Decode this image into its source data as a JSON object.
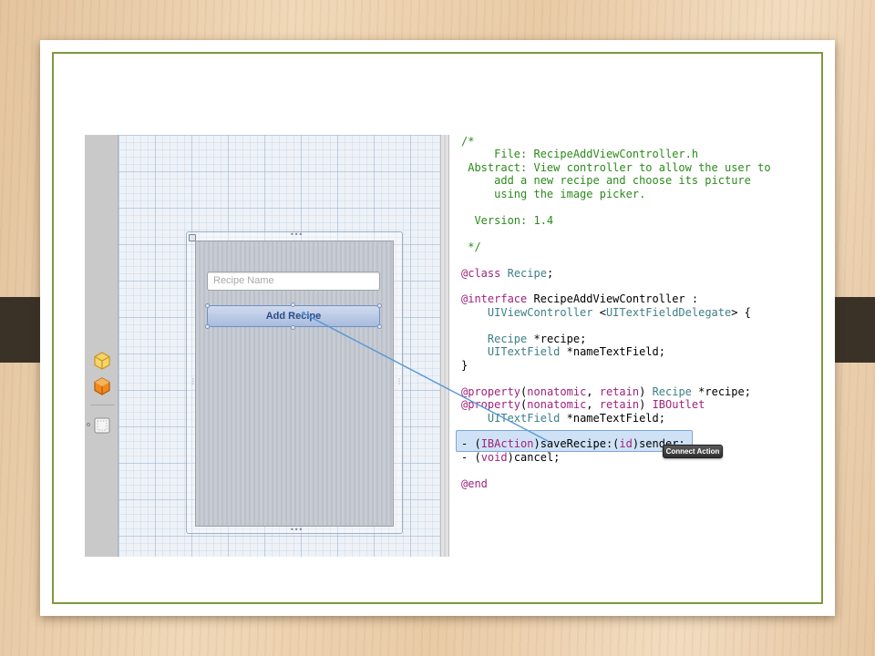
{
  "canvas": {
    "textfield_placeholder": "Recipe Name",
    "button_label": "Add Recipe"
  },
  "code_lines": [
    [
      {
        "t": "/*",
        "c": "comment"
      }
    ],
    [
      {
        "t": "     File: RecipeAddViewController.h",
        "c": "comment"
      }
    ],
    [
      {
        "t": " Abstract: View controller to allow the user to",
        "c": "comment"
      }
    ],
    [
      {
        "t": "     add a new recipe and choose its picture",
        "c": "comment"
      }
    ],
    [
      {
        "t": "     using the image picker.",
        "c": "comment"
      }
    ],
    [
      {
        "t": "",
        "c": "plain"
      }
    ],
    [
      {
        "t": "  Version: 1.4",
        "c": "comment"
      }
    ],
    [
      {
        "t": "",
        "c": "plain"
      }
    ],
    [
      {
        "t": " */",
        "c": "comment"
      }
    ],
    [
      {
        "t": "",
        "c": "plain"
      }
    ],
    [
      {
        "t": "@class",
        "c": "kw"
      },
      {
        "t": " ",
        "c": "plain"
      },
      {
        "t": "Recipe",
        "c": "type"
      },
      {
        "t": ";",
        "c": "plain"
      }
    ],
    [
      {
        "t": "",
        "c": "plain"
      }
    ],
    [
      {
        "t": "@interface",
        "c": "kw"
      },
      {
        "t": " RecipeAddViewController :",
        "c": "plain"
      }
    ],
    [
      {
        "t": "    ",
        "c": "plain"
      },
      {
        "t": "UIViewController",
        "c": "type"
      },
      {
        "t": " <",
        "c": "plain"
      },
      {
        "t": "UITextFieldDelegate",
        "c": "type"
      },
      {
        "t": "> {",
        "c": "plain"
      }
    ],
    [
      {
        "t": "",
        "c": "plain"
      }
    ],
    [
      {
        "t": "    ",
        "c": "plain"
      },
      {
        "t": "Recipe",
        "c": "type"
      },
      {
        "t": " *recipe;",
        "c": "plain"
      }
    ],
    [
      {
        "t": "    ",
        "c": "plain"
      },
      {
        "t": "UITextField",
        "c": "type"
      },
      {
        "t": " *nameTextField;",
        "c": "plain"
      }
    ],
    [
      {
        "t": "}",
        "c": "plain"
      }
    ],
    [
      {
        "t": "",
        "c": "plain"
      }
    ],
    [
      {
        "t": "@property",
        "c": "kw"
      },
      {
        "t": "(",
        "c": "plain"
      },
      {
        "t": "nonatomic",
        "c": "kw"
      },
      {
        "t": ", ",
        "c": "plain"
      },
      {
        "t": "retain",
        "c": "kw"
      },
      {
        "t": ") ",
        "c": "plain"
      },
      {
        "t": "Recipe",
        "c": "type"
      },
      {
        "t": " *recipe;",
        "c": "plain"
      }
    ],
    [
      {
        "t": "@property",
        "c": "kw"
      },
      {
        "t": "(",
        "c": "plain"
      },
      {
        "t": "nonatomic",
        "c": "kw"
      },
      {
        "t": ", ",
        "c": "plain"
      },
      {
        "t": "retain",
        "c": "kw"
      },
      {
        "t": ") ",
        "c": "plain"
      },
      {
        "t": "IBOutlet",
        "c": "kw"
      }
    ],
    [
      {
        "t": "    ",
        "c": "plain"
      },
      {
        "t": "UITextField",
        "c": "type"
      },
      {
        "t": " *nameTextField;",
        "c": "plain"
      }
    ],
    [
      {
        "t": "",
        "c": "plain"
      }
    ],
    [
      {
        "t": "- (",
        "c": "plain"
      },
      {
        "t": "IBAction",
        "c": "kw"
      },
      {
        "t": ")saveRecipe:(",
        "c": "plain"
      },
      {
        "t": "id",
        "c": "kw"
      },
      {
        "t": ")sender;",
        "c": "plain"
      }
    ],
    [
      {
        "t": "- (",
        "c": "plain"
      },
      {
        "t": "void",
        "c": "kw"
      },
      {
        "t": ")cancel;",
        "c": "plain"
      }
    ],
    [
      {
        "t": "",
        "c": "plain"
      }
    ],
    [
      {
        "t": "@end",
        "c": "kw"
      }
    ]
  ],
  "tooltip": "Connect Action",
  "colors": {
    "comment": "#2b8a1c",
    "keyword": "#a0227d",
    "type": "#3d7f87",
    "slide_border": "#7e9a3c"
  }
}
